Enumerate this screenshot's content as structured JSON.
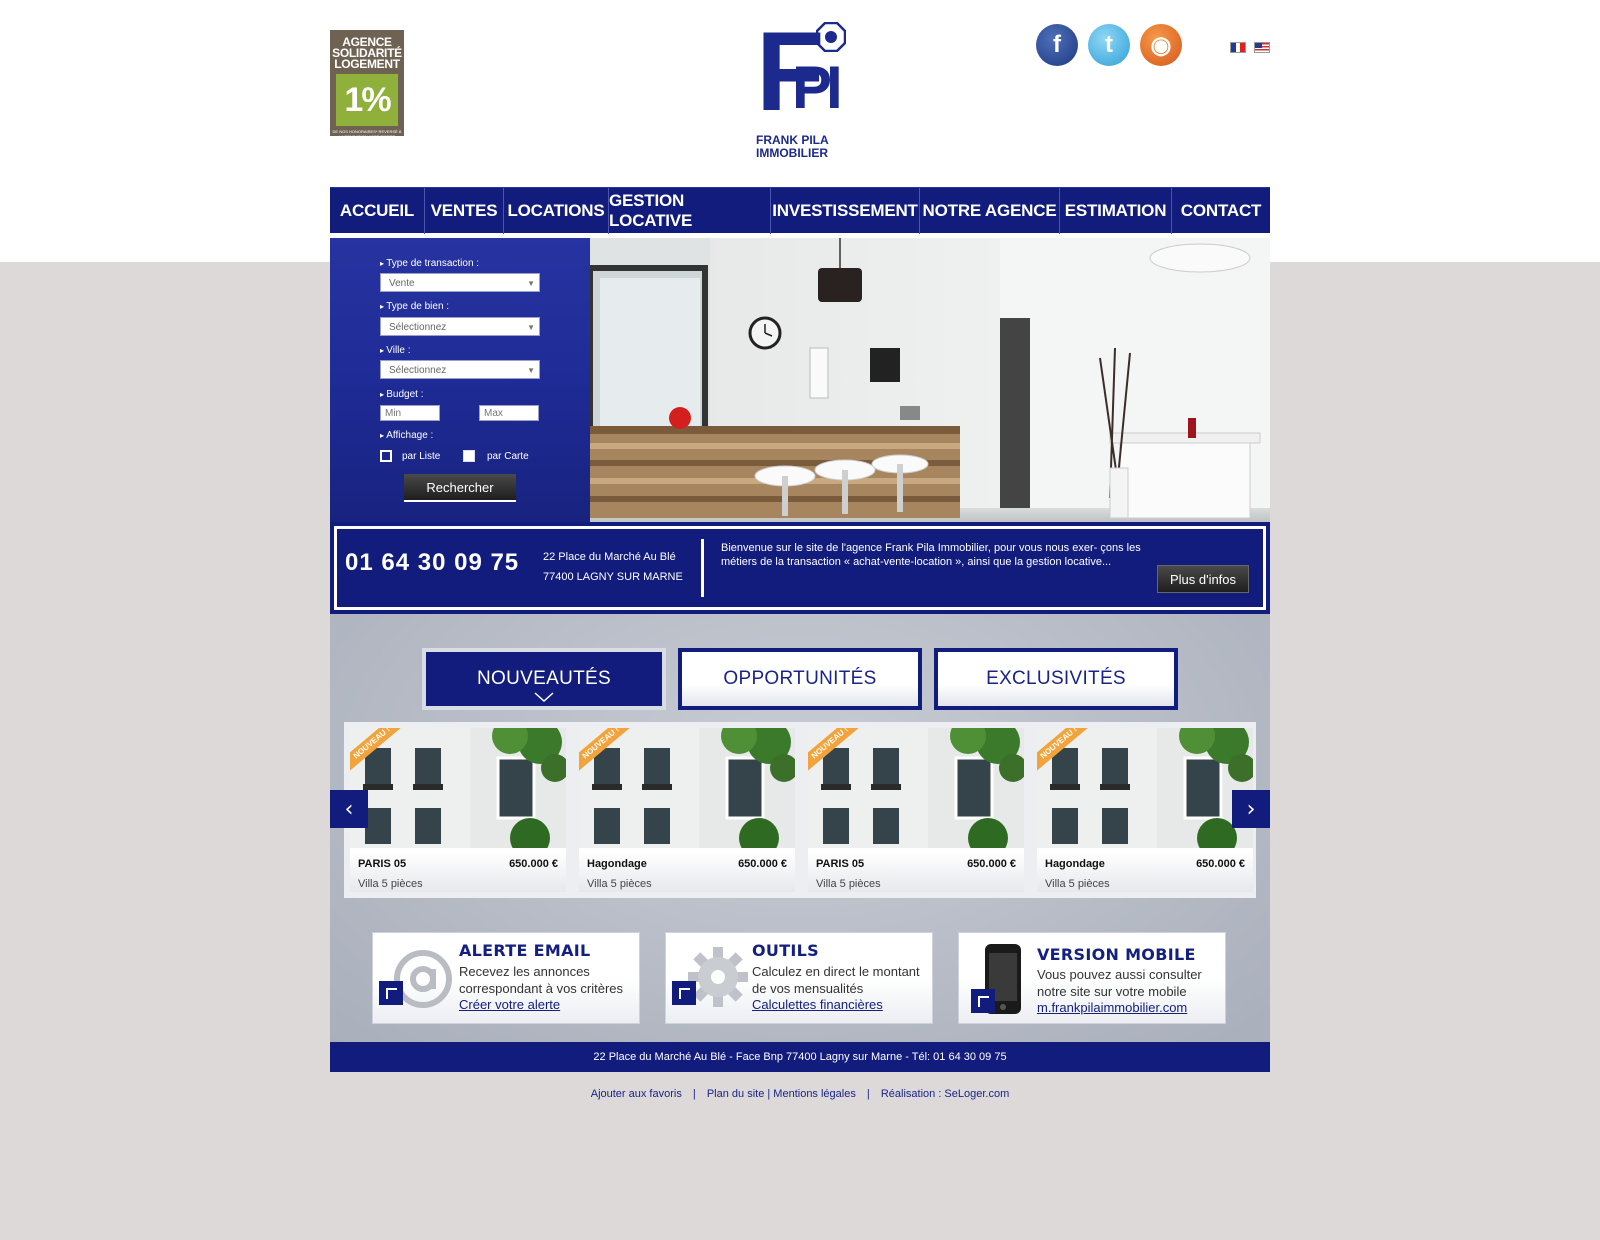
{
  "header": {
    "badge_lines": [
      "AGENCE",
      "SOLIDARITÉ",
      "LOGEMENT"
    ],
    "badge_percent": "1%",
    "badge_small": "DE NOS HONORAIRES* REVERSÉ À LA FONDATION ABBÉ PIERRE",
    "logo_letters": {
      "f": "F",
      "p": "P",
      "i": "I"
    },
    "logo_line1": "FRANK PILA",
    "logo_line2": "IMMOBILIER",
    "social": [
      {
        "name": "facebook",
        "glyph": "f"
      },
      {
        "name": "twitter",
        "glyph": "t"
      },
      {
        "name": "rss",
        "glyph": "◉"
      }
    ]
  },
  "nav": {
    "items": [
      {
        "label": "ACCUEIL"
      },
      {
        "label": "VENTES"
      },
      {
        "label": "LOCATIONS"
      },
      {
        "label": "GESTION LOCATIVE"
      },
      {
        "label": "INVESTISSEMENT"
      },
      {
        "label": "NOTRE AGENCE"
      },
      {
        "label": "ESTIMATION"
      },
      {
        "label": "CONTACT"
      }
    ]
  },
  "search": {
    "transaction_label": "Type de transaction :",
    "transaction_value": "Vente",
    "property_label": "Type de bien :",
    "property_value": "Sélectionnez",
    "city_label": "Ville :",
    "city_value": "Sélectionnez",
    "budget_label": "Budget :",
    "budget_min_placeholder": "Min",
    "budget_max_placeholder": "Max",
    "display_label": "Affichage :",
    "list_label": "par Liste",
    "map_label": "par Carte",
    "submit_label": "Rechercher"
  },
  "info": {
    "phone": "01 64 30 09 75",
    "address_line1": "22 Place du Marché Au Blé",
    "address_line2": "77400 LAGNY SUR MARNE",
    "welcome_text": "Bienvenue sur le site de l'agence Frank Pila Immobilier, pour vous nous exer- çons les métiers de la transaction « achat-vente-location », ainsi que la gestion locative...",
    "more_label": "Plus d'infos"
  },
  "tabs": [
    {
      "label": "NOUVEAUTÉS"
    },
    {
      "label": "OPPORTUNITÉS"
    },
    {
      "label": "EXCLUSIVITÉS"
    }
  ],
  "listings": [
    {
      "ribbon": "NOUVEAU !",
      "city": "PARIS 05",
      "price": "650.000 €",
      "kind": "Villa 5 pièces"
    },
    {
      "ribbon": "NOUVEAU !",
      "city": "Hagondage",
      "price": "650.000 €",
      "kind": "Villa 5 pièces"
    },
    {
      "ribbon": "NOUVEAU !",
      "city": "PARIS 05",
      "price": "650.000 €",
      "kind": "Villa 5 pièces"
    },
    {
      "ribbon": "NOUVEAU !",
      "city": "Hagondage",
      "price": "650.000 €",
      "kind": "Villa 5 pièces"
    }
  ],
  "carousel": {
    "prev_glyph": "‹",
    "next_glyph": "›"
  },
  "promos": {
    "email": {
      "title": "ALERTE EMAIL",
      "text": "Recevez les annonces correspondant à vos critères",
      "link": "Créer votre alerte"
    },
    "tools": {
      "title": "OUTILS",
      "text": "Calculez en direct le montant de vos mensualités",
      "link": "Calculettes financières "
    },
    "mobile": {
      "title": "VERSION MOBILE",
      "text": "Vous pouvez aussi consulter notre site sur votre mobile",
      "link": "m.frankpilaimmobilier.com "
    }
  },
  "footer": {
    "address": "22 Place du Marché Au Blé - Face Bnp 77400 Lagny sur Marne - Tél: 01 64 30 09 75",
    "favorites": "Ajouter aux favoris",
    "sitemap": "Plan du site",
    "legal": "Mentions légales",
    "credit": "Réalisation : SeLoger.com",
    "separator": "|"
  },
  "colors": {
    "brand_blue": "#121c7d",
    "accent_orange": "#f2a33c",
    "badge_green": "#8fb03a"
  }
}
